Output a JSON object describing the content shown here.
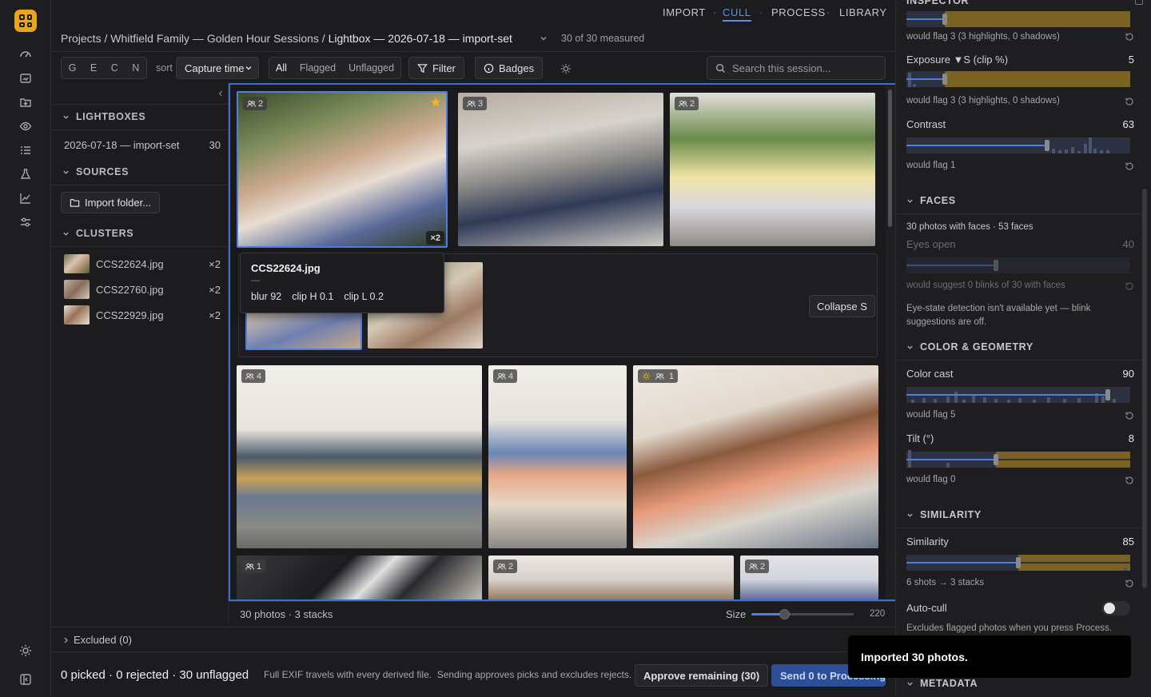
{
  "app": {
    "accent": "#3e6fd0",
    "brand": "#e8a71a"
  },
  "nav": {
    "import": "IMPORT",
    "cull": "CULL",
    "process": "PROCESS",
    "library": "LIBRARY",
    "sep": "·"
  },
  "breadcrumb": {
    "projects": "Projects",
    "sep": " / ",
    "project": "Whitfield Family — Golden Hour Sessions",
    "current": "Lightbox — 2026-07-18 — import-set",
    "measured": "30 of 30 measured"
  },
  "toolbar": {
    "grade_keys": [
      "G",
      "E",
      "C",
      "N"
    ],
    "sort_label": "sort",
    "sort_value": "Capture time",
    "filters": [
      "All",
      "Flagged",
      "Unflagged"
    ],
    "filter_button": "Filter",
    "badges_button": "Badges",
    "search_placeholder": "Search this session..."
  },
  "sidebar": {
    "lightboxes_title": "LIGHTBOXES",
    "lightbox": {
      "name": "2026-07-18 — import-set",
      "count": "30"
    },
    "sources_title": "SOURCES",
    "import_button": "Import folder...",
    "clusters_title": "CLUSTERS",
    "clusters": [
      {
        "name": "CCS22624.jpg",
        "count": "×2"
      },
      {
        "name": "CCS22760.jpg",
        "count": "×2"
      },
      {
        "name": "CCS22929.jpg",
        "count": "×2"
      }
    ]
  },
  "grid": {
    "photos": [
      {
        "faces": "2",
        "stack": "×2",
        "starred": true
      },
      {
        "faces": "3"
      },
      {
        "faces": "2"
      },
      {
        "faces": "4"
      },
      {
        "faces": "4"
      },
      {
        "faces": "1",
        "sun": true
      },
      {
        "faces": "1"
      },
      {
        "faces": "2"
      },
      {
        "faces": "2"
      }
    ],
    "tooltip": {
      "filename": "CCS22624.jpg",
      "dash": "—",
      "blur": "blur 92",
      "clip_h": "clip H 0.1",
      "clip_l": "clip L 0.2"
    },
    "collapse_button": "Collapse S",
    "footer_count": "30 photos · 3 stacks",
    "size_label": "Size",
    "size_value": "220",
    "size_fraction": 0.32
  },
  "excluded": "Excluded (0)",
  "bottom": {
    "summary": "0 picked · 0 rejected · 30 unflagged",
    "note": "Full EXIF travels with every derived file.  Sending approves picks and excludes rejects.",
    "approve_button": "Approve remaining (30)",
    "send_button": "Send 0 to Processing"
  },
  "inspector": {
    "title": "INSPECTOR",
    "flag_top": "would flag 3 (3 highlights, 0 shadows)",
    "exposure": {
      "label": "Exposure ▼S (clip %)",
      "value": "5",
      "flag": "would flag 3 (3 highlights, 0 shadows)",
      "fraction": 0.17
    },
    "contrast": {
      "label": "Contrast",
      "value": "63",
      "flag": "would flag 1",
      "fraction": 0.63
    },
    "faces_title": "FACES",
    "faces_summary": "30 photos with faces · 53 faces",
    "eyes": {
      "label": "Eyes open",
      "value": "40",
      "flag": "would suggest 0 blinks of 30 with faces",
      "fraction": 0.4
    },
    "eyes_note": "Eye-state detection isn't available yet — blink suggestions are off.",
    "color_title": "COLOR & GEOMETRY",
    "color_cast": {
      "label": "Color cast",
      "value": "90",
      "flag": "would flag 5",
      "fraction": 0.9
    },
    "tilt": {
      "label": "Tilt (°)",
      "value": "8",
      "flag": "would flag 0",
      "fraction": 0.4
    },
    "similarity_title": "SIMILARITY",
    "similarity": {
      "label": "Similarity",
      "value": "85",
      "flag": "6 shots → 3 stacks",
      "fraction": 0.5
    },
    "autocull": {
      "label": "Auto-cull",
      "desc": "Excludes flagged photos when you press Process.",
      "on": false
    },
    "metadata_title": "METADATA"
  },
  "toast": "Imported 30 photos."
}
